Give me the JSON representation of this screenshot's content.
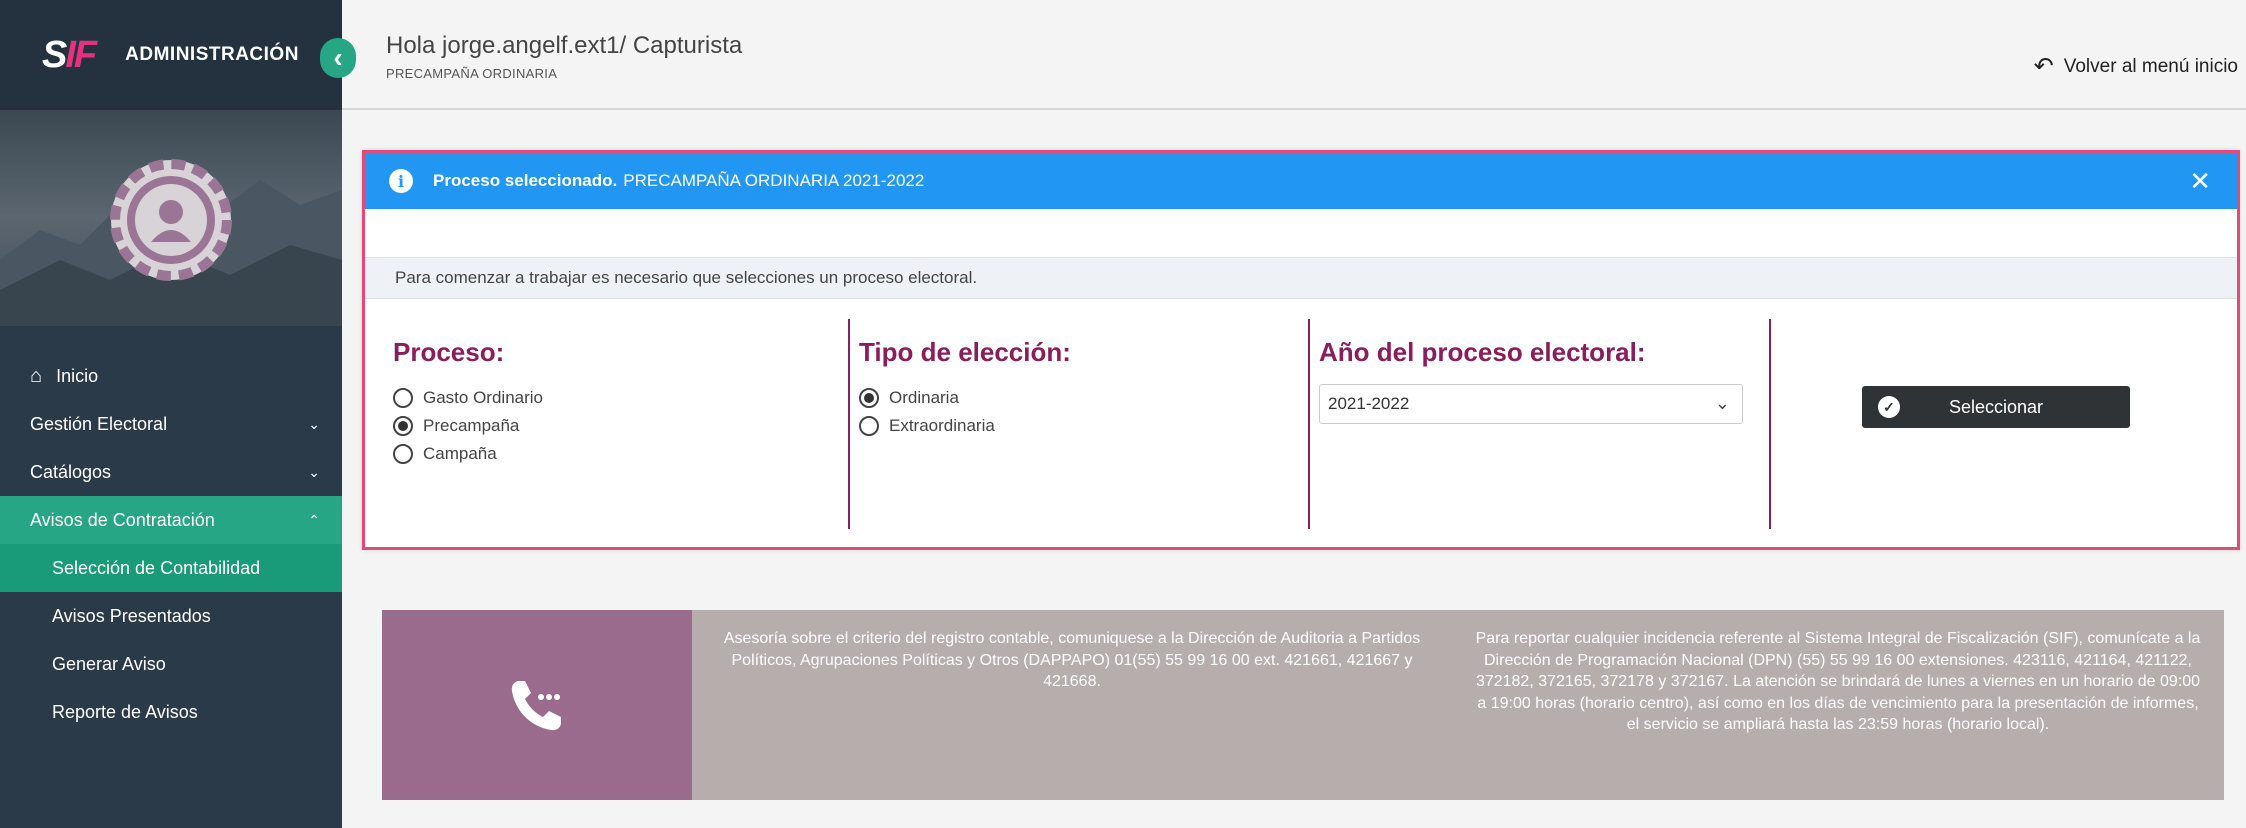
{
  "brand": {
    "logo_s": "S",
    "logo_if": "IF",
    "title": "ADMINISTRACIÓN"
  },
  "sidebar": {
    "items": [
      {
        "label": "Inicio"
      },
      {
        "label": "Gestión Electoral"
      },
      {
        "label": "Catálogos"
      },
      {
        "label": "Avisos de Contratación"
      }
    ],
    "subitems": [
      {
        "label": "Selección de Contabilidad"
      },
      {
        "label": "Avisos Presentados"
      },
      {
        "label": "Generar Aviso"
      },
      {
        "label": "Reporte de Avisos"
      }
    ]
  },
  "header": {
    "greeting": "Hola jorge.angelf.ext1/ Capturista",
    "subtitle": "PRECAMPAÑA ORDINARIA",
    "back_label": "Volver al menú inicio"
  },
  "alert": {
    "bold": "Proceso seleccionado.",
    "text": "PRECAMPAÑA ORDINARIA 2021-2022",
    "close": "✕"
  },
  "hint": "Para comenzar a trabajar es necesario que selecciones un proceso electoral.",
  "proceso": {
    "title": "Proceso:",
    "options": [
      {
        "label": "Gasto Ordinario",
        "checked": false
      },
      {
        "label": "Precampaña",
        "checked": true
      },
      {
        "label": "Campaña",
        "checked": false
      }
    ]
  },
  "tipo": {
    "title": "Tipo de elección:",
    "options": [
      {
        "label": "Ordinaria",
        "checked": true
      },
      {
        "label": "Extraordinaria",
        "checked": false
      }
    ]
  },
  "anio": {
    "title": "Año del proceso electoral:",
    "selected": "2021-2022"
  },
  "select_button": "Seleccionar",
  "footer": {
    "text_a": "Asesoría sobre el criterio del registro contable, comuniquese a la Dirección de Auditoria a Partidos Políticos, Agrupaciones Políticas y Otros (DAPPAPO) 01(55) 55 99 16 00 ext. 421661, 421667 y 421668.",
    "text_b": "Para reportar cualquier incidencia referente al Sistema Integral de Fiscalización (SIF), comunícate a la Dirección de Programación Nacional (DPN) (55) 55 99 16 00 extensiones. 423116, 421164, 421122, 372182, 372165, 372178 y 372167. La atención se brindará de lunes a viernes en un horario de 09:00 a 19:00 horas (horario centro), así como en los días de vencimiento para la presentación de informes, el servicio se ampliará hasta las 23:59 horas (horario local)."
  },
  "colors": {
    "accent": "#26a684",
    "sidebar": "#2a3a48",
    "title": "#8a1d5c",
    "alert": "#2196f3",
    "panel_border": "#e24a7b"
  }
}
